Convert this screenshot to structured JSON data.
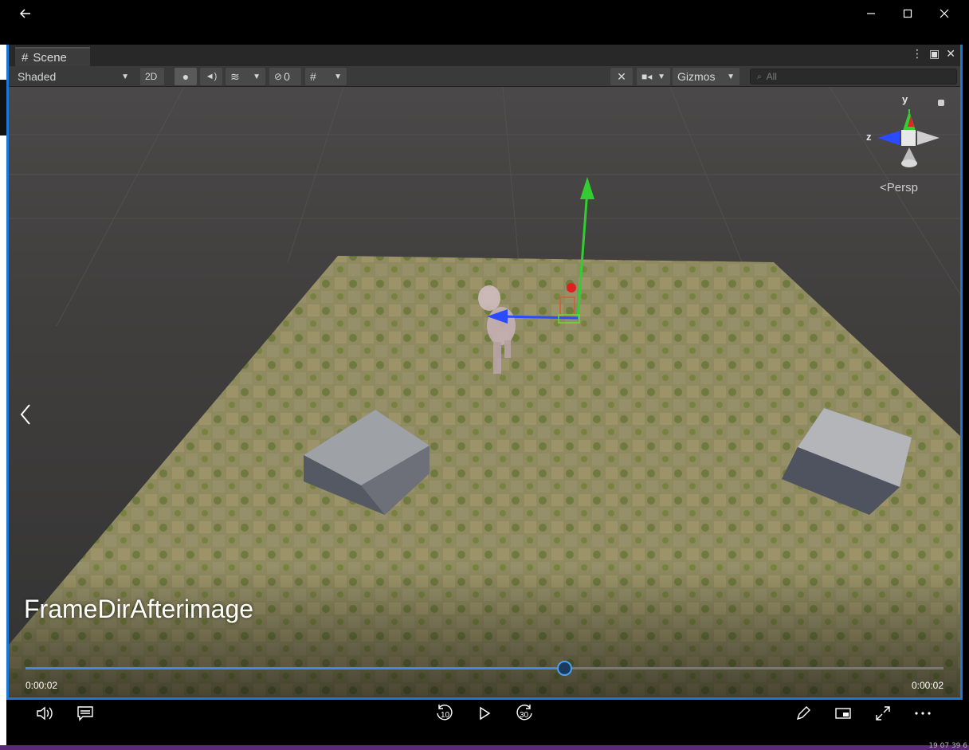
{
  "window": {
    "back_icon": "arrow-left-icon",
    "minimize_icon": "minimize-icon",
    "maximize_icon": "maximize-icon",
    "close_icon": "close-icon",
    "corner_text": "19 07 39 6"
  },
  "unity": {
    "tab_icon": "grid-icon",
    "tab_label": "Scene",
    "shading_mode": "Shaded",
    "btn_2d": "2D",
    "hidden_count": "0",
    "gizmos_label": "Gizmos",
    "search_placeholder": "All",
    "axis_y": "y",
    "axis_z": "z",
    "persp_label": "Persp"
  },
  "video": {
    "title": "FrameDirAfterimage",
    "time_elapsed": "0:00:02",
    "time_total": "0:00:02",
    "progress": 0.588
  },
  "controls": {
    "skip_back_label": "10",
    "skip_forward_label": "30"
  },
  "colors": {
    "accent": "#1b78d4",
    "seek_fill": "#3a8de0",
    "axis_x": "#e02020",
    "axis_y": "#33cc33",
    "axis_z": "#2a4bff"
  }
}
